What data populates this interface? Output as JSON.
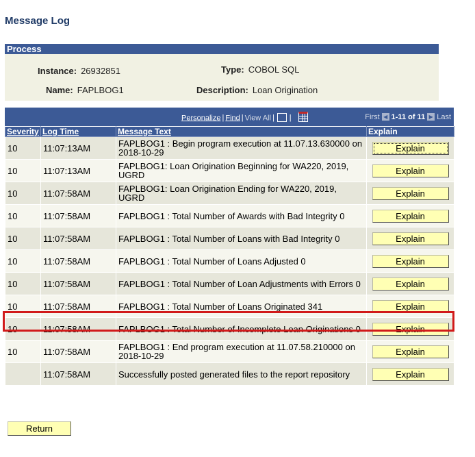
{
  "page": {
    "title": "Message Log"
  },
  "process": {
    "header": "Process",
    "instance_label": "Instance:",
    "instance_value": "26932851",
    "type_label": "Type:",
    "type_value": "COBOL SQL",
    "name_label": "Name:",
    "name_value": "FAPLBOG1",
    "description_label": "Description:",
    "description_value": "Loan Origination"
  },
  "toolbar": {
    "personalize": "Personalize",
    "find": "Find",
    "view_all": "View All",
    "first": "First",
    "range": "1-11 of 11",
    "last": "Last"
  },
  "columns": {
    "severity": "Severity",
    "log_time": "Log Time",
    "message_text": "Message Text",
    "explain": "Explain"
  },
  "rows": [
    {
      "severity": "10",
      "time": "11:07:13AM",
      "message": "FAPLBOG1 : Begin program execution at 11.07.13.630000 on 2018-10-29",
      "button": "Explain"
    },
    {
      "severity": "10",
      "time": "11:07:13AM",
      "message": "FAPLBOG1: Loan Origination Beginning for WA220, 2019, UGRD",
      "button": "Explain"
    },
    {
      "severity": "10",
      "time": "11:07:58AM",
      "message": "FAPLBOG1: Loan Origination Ending for WA220, 2019, UGRD",
      "button": "Explain"
    },
    {
      "severity": "10",
      "time": "11:07:58AM",
      "message": "FAPLBOG1 : Total Number of Awards with Bad Integrity 0",
      "button": "Explain"
    },
    {
      "severity": "10",
      "time": "11:07:58AM",
      "message": "FAPLBOG1 : Total Number of Loans with Bad Integrity 0",
      "button": "Explain"
    },
    {
      "severity": "10",
      "time": "11:07:58AM",
      "message": "FAPLBOG1 : Total Number of Loans Adjusted 0",
      "button": "Explain"
    },
    {
      "severity": "10",
      "time": "11:07:58AM",
      "message": "FAPLBOG1 : Total Number of Loan Adjustments with Errors 0",
      "button": "Explain"
    },
    {
      "severity": "10",
      "time": "11:07:58AM",
      "message": "FAPLBOG1 : Total Number of Loans Originated 341",
      "button": "Explain"
    },
    {
      "severity": "10",
      "time": "11:07:58AM",
      "message": "FAPLBOG1 : Total Number of Incomplete Loan Originations 0",
      "button": "Explain"
    },
    {
      "severity": "10",
      "time": "11:07:58AM",
      "message": "FAPLBOG1 : End program execution at 11.07.58.210000 on 2018-10-29",
      "button": "Explain"
    },
    {
      "severity": "",
      "time": "11:07:58AM",
      "message": "Successfully posted generated files to the report repository",
      "button": "Explain"
    }
  ],
  "footer": {
    "return_label": "Return"
  },
  "colors": {
    "header_bg": "#3c5a96",
    "row_odd": "#e6e6da",
    "row_even": "#f6f6ee",
    "button_bg": "#ffffb4",
    "highlight": "#d11a1a"
  }
}
